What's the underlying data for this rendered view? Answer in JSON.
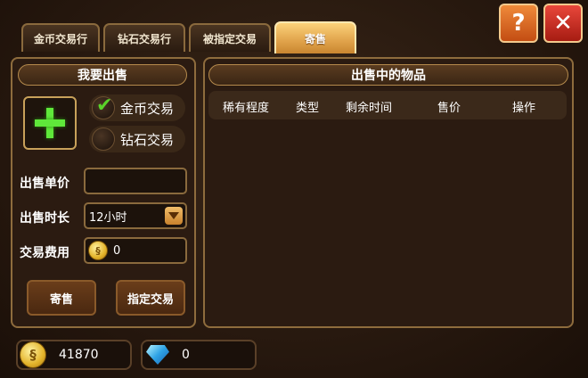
{
  "tabs": [
    {
      "label": "金币交易行",
      "active": false
    },
    {
      "label": "钻石交易行",
      "active": false
    },
    {
      "label": "被指定交易",
      "active": false
    },
    {
      "label": "寄售",
      "active": true
    }
  ],
  "buttons": {
    "help": "?",
    "close": "✕"
  },
  "sell_panel": {
    "title": "我要出售",
    "add_icon": "plus-icon",
    "currency_options": [
      {
        "label": "金币交易",
        "selected": true
      },
      {
        "label": "钻石交易",
        "selected": false
      }
    ],
    "price": {
      "label": "出售单价",
      "value": ""
    },
    "duration": {
      "label": "出售时长",
      "value": "12小时"
    },
    "fee": {
      "label": "交易费用",
      "value": "0"
    },
    "consign_button": "寄售",
    "designated_button": "指定交易"
  },
  "items_panel": {
    "title": "出售中的物品",
    "columns": [
      "稀有程度",
      "类型",
      "剩余时间",
      "售价",
      "操作"
    ],
    "rows": []
  },
  "balances": {
    "gold": "41870",
    "diamond": "0"
  },
  "colors": {
    "accent": "#e0a24a",
    "frame": "#8e6c3d",
    "check": "#5ad42a"
  }
}
